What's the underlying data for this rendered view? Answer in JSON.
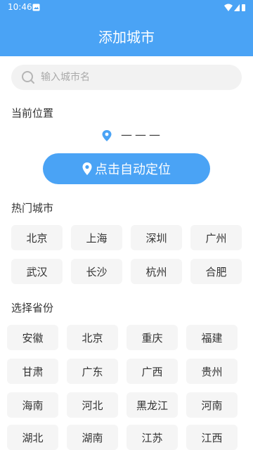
{
  "status_bar": {
    "time": "10:46"
  },
  "header": {
    "title": "添加城市"
  },
  "search": {
    "placeholder": "输入城市名"
  },
  "current_location": {
    "label": "当前位置",
    "value": "———",
    "locate_button": "点击自动定位"
  },
  "hot_cities": {
    "label": "热门城市",
    "items": [
      "北京",
      "上海",
      "深圳",
      "广州",
      "武汉",
      "长沙",
      "杭州",
      "合肥"
    ]
  },
  "provinces": {
    "label": "选择省份",
    "items": [
      "安徽",
      "北京",
      "重庆",
      "福建",
      "甘肃",
      "广东",
      "广西",
      "贵州",
      "海南",
      "河北",
      "黑龙江",
      "河南",
      "湖北",
      "湖南",
      "江苏",
      "江西"
    ]
  },
  "colors": {
    "accent": "#4aa3f5",
    "chip_bg": "#f5f5f5"
  },
  "icons": [
    "notification-icon",
    "wifi-icon",
    "signal-icon",
    "battery-icon",
    "search-icon",
    "location-pin-icon"
  ]
}
